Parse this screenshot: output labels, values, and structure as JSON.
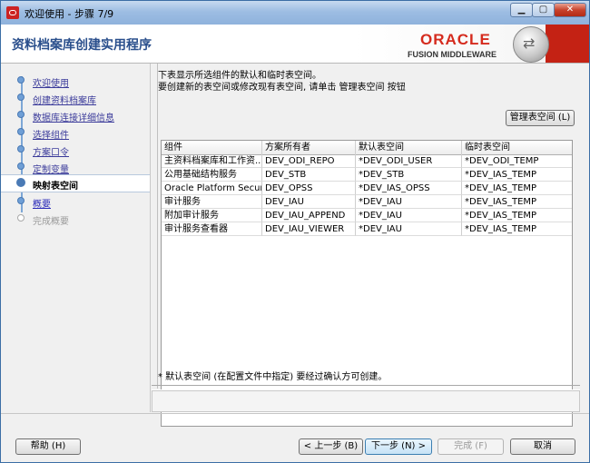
{
  "window": {
    "title": "欢迎使用 - 步骤 7/9"
  },
  "header": {
    "title": "资料档案库创建实用程序",
    "brand": "ORACLE",
    "brand_sub": "FUSION MIDDLEWARE"
  },
  "sidebar": {
    "items": [
      {
        "label": "欢迎使用",
        "state": "done"
      },
      {
        "label": "创建资料档案库",
        "state": "done"
      },
      {
        "label": "数据库连接详细信息",
        "state": "done"
      },
      {
        "label": "选择组件",
        "state": "done"
      },
      {
        "label": "方案口令",
        "state": "done"
      },
      {
        "label": "定制变量",
        "state": "done"
      },
      {
        "label": "映射表空间",
        "state": "active"
      },
      {
        "label": "概要",
        "state": "next"
      },
      {
        "label": "完成概要",
        "state": "disabled"
      }
    ]
  },
  "main": {
    "desc_line1": "下表显示所选组件的默认和临时表空间。",
    "desc_line2": "要创建新的表空间或修改现有表空间, 请单击 管理表空间 按钮",
    "manage_button": "管理表空间 (L)",
    "table": {
      "headers": [
        "组件",
        "方案所有者",
        "默认表空间",
        "临时表空间"
      ],
      "rows": [
        [
          "主资料档案库和工作资...",
          "DEV_ODI_REPO",
          "*DEV_ODI_USER",
          "*DEV_ODI_TEMP"
        ],
        [
          "公用基础结构服务",
          "DEV_STB",
          "*DEV_STB",
          "*DEV_IAS_TEMP"
        ],
        [
          "Oracle Platform Securit...",
          "DEV_OPSS",
          "*DEV_IAS_OPSS",
          "*DEV_IAS_TEMP"
        ],
        [
          "审计服务",
          "DEV_IAU",
          "*DEV_IAU",
          "*DEV_IAS_TEMP"
        ],
        [
          "附加审计服务",
          "DEV_IAU_APPEND",
          "*DEV_IAU",
          "*DEV_IAS_TEMP"
        ],
        [
          "审计服务查看器",
          "DEV_IAU_VIEWER",
          "*DEV_IAU",
          "*DEV_IAS_TEMP"
        ]
      ]
    },
    "footnote": "* 默认表空间 (在配置文件中指定) 要经过确认方可创建。"
  },
  "buttons": {
    "help": "帮助 (H)",
    "back": "< 上一步 (B)",
    "next": "下一步 (N) >",
    "finish": "完成 (F)",
    "cancel": "取消"
  }
}
